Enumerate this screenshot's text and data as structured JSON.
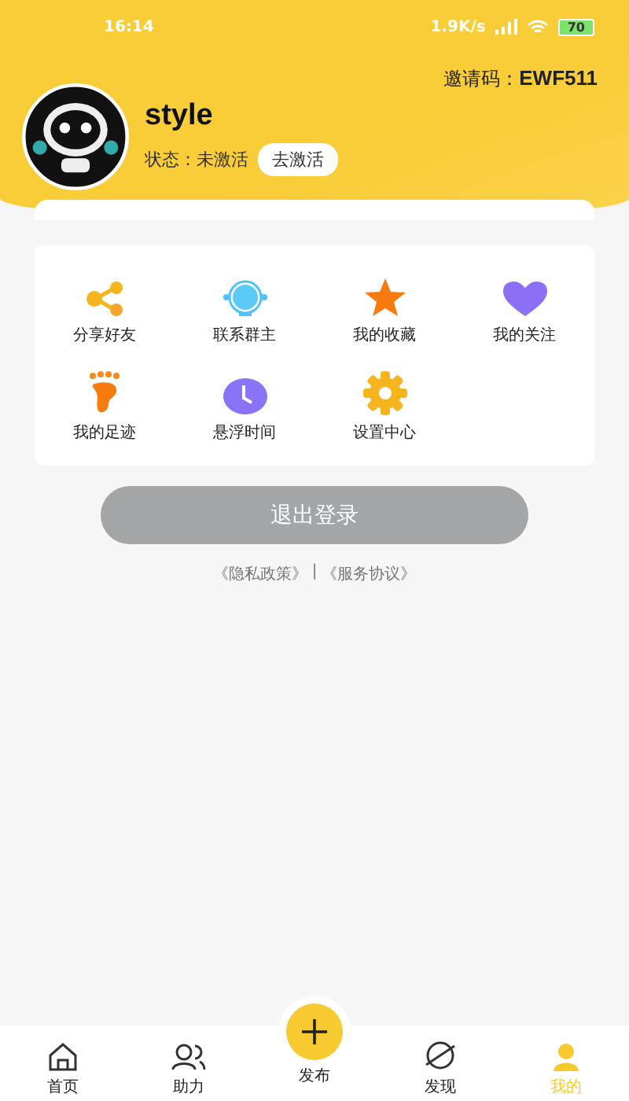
{
  "status_bar": {
    "time": "16:14",
    "speed": "1.9K/s",
    "battery": "70"
  },
  "profile": {
    "invite_label": "邀请码：",
    "invite_code": "EWF511",
    "name": "style",
    "status_label": "状态：",
    "status_value": "未激活",
    "activate_button": "去激活"
  },
  "menu": [
    {
      "kind": "share",
      "label": "分享好友"
    },
    {
      "kind": "headset",
      "label": "联系群主"
    },
    {
      "kind": "star",
      "label": "我的收藏"
    },
    {
      "kind": "heart",
      "label": "我的关注"
    },
    {
      "kind": "foot",
      "label": "我的足迹"
    },
    {
      "kind": "clock",
      "label": "悬浮时间"
    },
    {
      "kind": "gear",
      "label": "设置中心"
    }
  ],
  "logout_button": {
    "label": "退出登录",
    "disabled": true
  },
  "links": {
    "privacy": "《隐私政策》",
    "separator": "|",
    "terms": "《服务协议》"
  },
  "tabs": [
    {
      "kind": "home",
      "label": "首页",
      "selected": false
    },
    {
      "kind": "people",
      "label": "助力",
      "selected": false
    },
    {
      "kind": "publish",
      "label": "发布",
      "selected": false
    },
    {
      "kind": "discover",
      "label": "发现",
      "selected": false
    },
    {
      "kind": "me",
      "label": "我的",
      "selected": true
    }
  ]
}
